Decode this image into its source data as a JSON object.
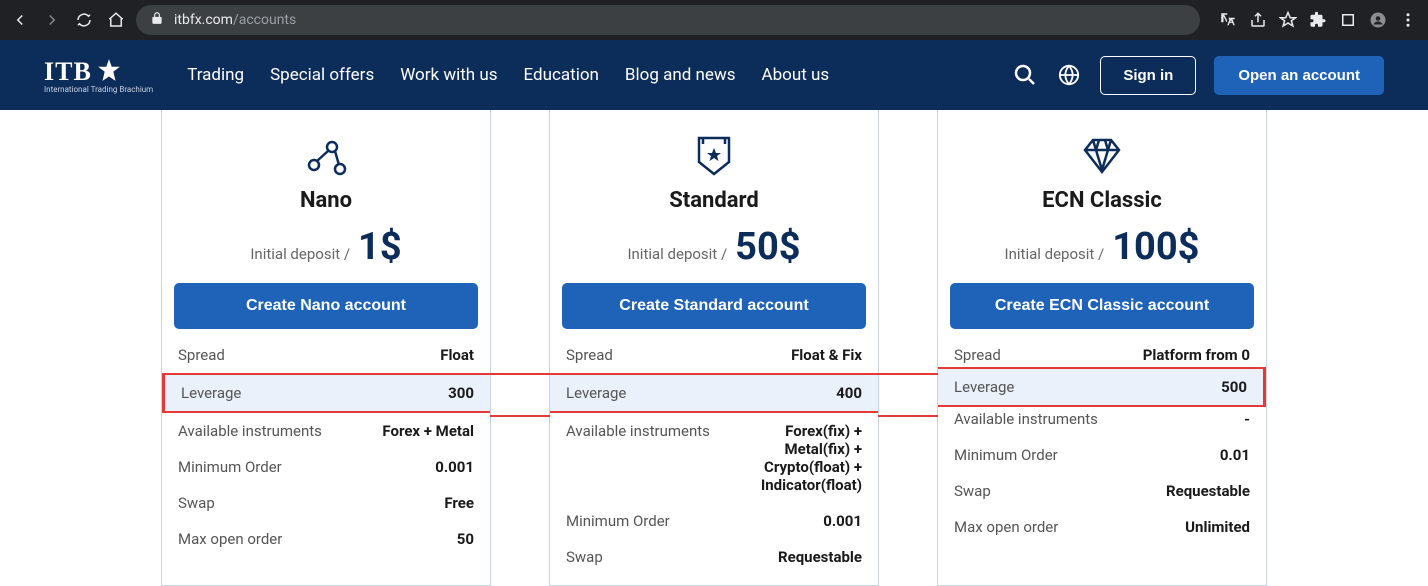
{
  "browser": {
    "url_prefix": "itbfx.com",
    "url_path": "/accounts"
  },
  "logo": {
    "text": "ITB",
    "sub": "International Trading Brachium"
  },
  "nav": {
    "trading": "Trading",
    "offers": "Special offers",
    "work": "Work with us",
    "education": "Education",
    "blog": "Blog and news",
    "about": "About us"
  },
  "header": {
    "signin": "Sign in",
    "open": "Open an account"
  },
  "labels": {
    "deposit": "Initial deposit /",
    "spread": "Spread",
    "leverage": "Leverage",
    "instruments": "Available instruments",
    "minorder": "Minimum Order",
    "swap": "Swap",
    "maxopen": "Max open order"
  },
  "cards": {
    "nano": {
      "title": "Nano",
      "amount": "1$",
      "button": "Create Nano account",
      "spread": "Float",
      "leverage": "300",
      "instruments": "Forex + Metal",
      "minorder": "0.001",
      "swap": "Free",
      "maxopen": "50"
    },
    "standard": {
      "title": "Standard",
      "amount": "50$",
      "button": "Create Standard account",
      "spread": "Float & Fix",
      "leverage": "400",
      "instruments": "Forex(fix) + Metal(fix) + Crypto(float) + Indicator(float)",
      "minorder": "0.001",
      "swap": "Requestable"
    },
    "ecn": {
      "title": "ECN Classic",
      "amount": "100$",
      "button": "Create ECN Classic account",
      "spread": "Platform from 0",
      "leverage": "500",
      "instruments": "-",
      "minorder": "0.01",
      "swap": "Requestable",
      "maxopen": "Unlimited"
    }
  }
}
